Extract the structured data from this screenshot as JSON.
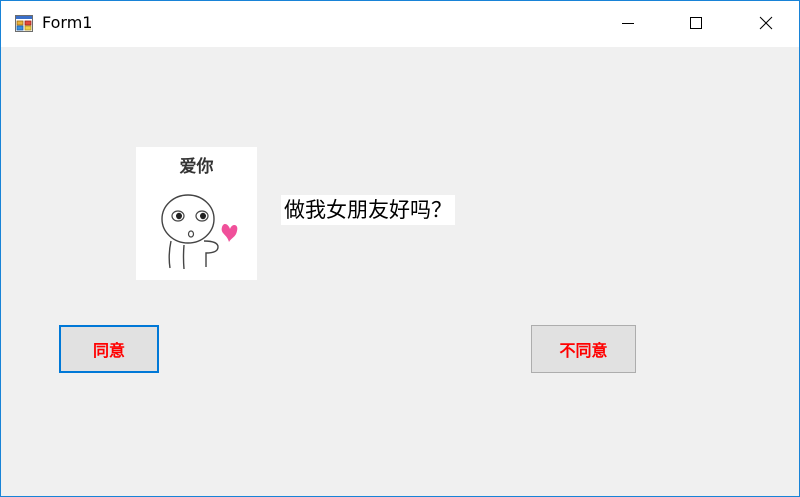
{
  "window": {
    "title": "Form1",
    "accent_color": "#1883d7",
    "background_color": "#f0f0f0"
  },
  "titlebar": {
    "app_icon": "form-app-icon",
    "buttons": [
      {
        "name": "minimize",
        "icon": "minimize-icon"
      },
      {
        "name": "maximize",
        "icon": "maximize-icon"
      },
      {
        "name": "close",
        "icon": "close-icon"
      }
    ]
  },
  "picture": {
    "caption": "爱你",
    "icon": "cartoon-heart-sticker"
  },
  "question": {
    "text": "做我女朋友好吗？"
  },
  "buttons": {
    "agree_label": "同意",
    "disagree_label": "不同意",
    "label_color": "#ff0000"
  }
}
